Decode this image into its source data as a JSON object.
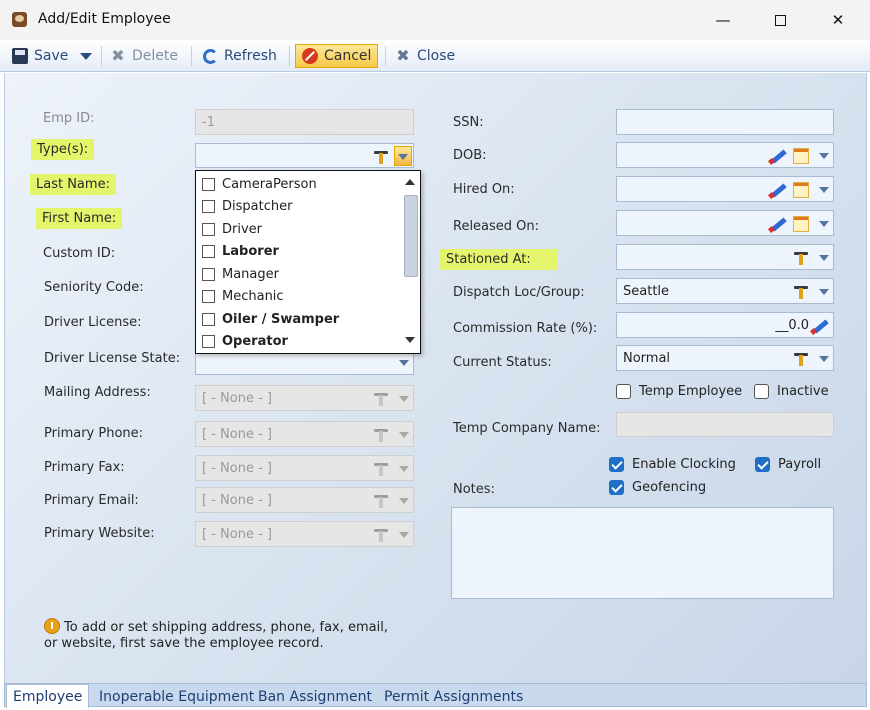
{
  "window": {
    "title": "Add/Edit Employee",
    "min": "—",
    "close": "✕"
  },
  "toolbar": {
    "save": "Save",
    "delete": "Delete",
    "refresh": "Refresh",
    "cancel": "Cancel",
    "close": "Close"
  },
  "left": {
    "emp_id_label": "Emp ID:",
    "emp_id_value": "-1",
    "types_label": "Type(s):",
    "last_name_label": "Last Name:",
    "first_name_label": "First Name:",
    "custom_id_label": "Custom ID:",
    "seniority_label": "Seniority Code:",
    "driver_license_label": "Driver License:",
    "driver_license_state_label": "Driver License State:",
    "mailing_address_label": "Mailing Address:",
    "primary_phone_label": "Primary Phone:",
    "primary_fax_label": "Primary Fax:",
    "primary_email_label": "Primary Email:",
    "primary_website_label": "Primary Website:",
    "none_value": "[ - None - ]"
  },
  "type_options": [
    "CameraPerson",
    "Dispatcher",
    "Driver",
    "Laborer",
    "Manager",
    "Mechanic",
    "Oiler / Swamper",
    "Operator"
  ],
  "right": {
    "ssn_label": "SSN:",
    "dob_label": "DOB:",
    "hired_on_label": "Hired On:",
    "released_on_label": "Released On:",
    "stationed_at_label": "Stationed At:",
    "dispatch_label": "Dispatch Loc/Group:",
    "dispatch_value": "Seattle",
    "commission_label": "Commission Rate (%):",
    "commission_value": "__0.0",
    "status_label": "Current Status:",
    "status_value": "Normal",
    "temp_employee": "Temp Employee",
    "inactive": "Inactive",
    "temp_company_label": "Temp Company Name:",
    "enable_clocking": "Enable Clocking",
    "payroll": "Payroll",
    "geofencing": "Geofencing",
    "notes_label": "Notes:"
  },
  "info_text": "To add or set shipping address, phone, fax, email, or website, first save the employee record.",
  "tabs": [
    "Employee",
    "Inoperable Equipment",
    "Ban Assignment",
    "Permit Assignments"
  ]
}
